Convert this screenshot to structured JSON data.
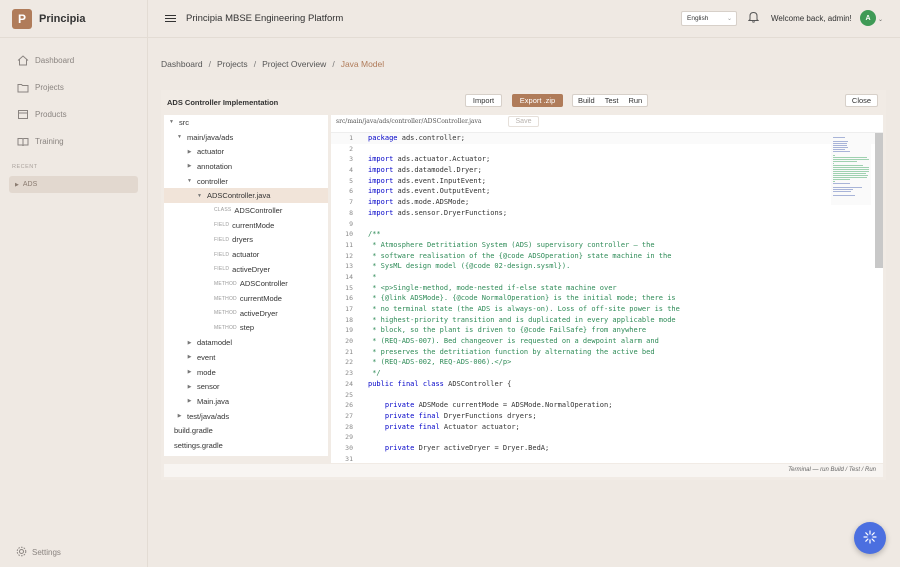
{
  "brand": {
    "logo": "P",
    "name": "Principia"
  },
  "nav": [
    {
      "label": "Dashboard",
      "icon": "home-icon"
    },
    {
      "label": "Projects",
      "icon": "folder-icon"
    },
    {
      "label": "Products",
      "icon": "box-icon"
    },
    {
      "label": "Training",
      "icon": "book-icon"
    }
  ],
  "recent": {
    "label": "RECENT",
    "items": [
      "ADS"
    ]
  },
  "settings": {
    "label": "Settings",
    "icon": "gear-icon"
  },
  "header": {
    "title": "Principia MBSE Engineering Platform",
    "language": "English",
    "welcome": "Welcome back, admin!",
    "avatar": "A"
  },
  "breadcrumb": [
    "Dashboard",
    "Projects",
    "Project Overview",
    "Java Model"
  ],
  "panel": {
    "title": "ADS Controller Implementation",
    "import": "Import",
    "export": "Export .zip",
    "build": "Build",
    "test": "Test",
    "run": "Run",
    "close": "Close"
  },
  "tree": [
    {
      "label": "src",
      "indent": 0,
      "arrow": "open"
    },
    {
      "label": "main/java/ads",
      "indent": 1,
      "arrow": "open"
    },
    {
      "label": "actuator",
      "indent": 2,
      "arrow": "closed"
    },
    {
      "label": "annotation",
      "indent": 2,
      "arrow": "closed"
    },
    {
      "label": "controller",
      "indent": 2,
      "arrow": "open"
    },
    {
      "label": "ADSController.java",
      "indent": 3,
      "arrow": "open",
      "selected": true
    },
    {
      "label": "ADSController",
      "indent": 4,
      "kind": "CLASS"
    },
    {
      "label": "currentMode",
      "indent": 4,
      "kind": "FIELD"
    },
    {
      "label": "dryers",
      "indent": 4,
      "kind": "FIELD"
    },
    {
      "label": "actuator",
      "indent": 4,
      "kind": "FIELD"
    },
    {
      "label": "activeDryer",
      "indent": 4,
      "kind": "FIELD"
    },
    {
      "label": "ADSController",
      "indent": 4,
      "kind": "METHOD"
    },
    {
      "label": "currentMode",
      "indent": 4,
      "kind": "METHOD"
    },
    {
      "label": "activeDryer",
      "indent": 4,
      "kind": "METHOD"
    },
    {
      "label": "step",
      "indent": 4,
      "kind": "METHOD"
    },
    {
      "label": "datamodel",
      "indent": 2,
      "arrow": "closed"
    },
    {
      "label": "event",
      "indent": 2,
      "arrow": "closed"
    },
    {
      "label": "mode",
      "indent": 2,
      "arrow": "closed"
    },
    {
      "label": "sensor",
      "indent": 2,
      "arrow": "closed"
    },
    {
      "label": "Main.java",
      "indent": 2,
      "arrow": "closed"
    },
    {
      "label": "test/java/ads",
      "indent": 1,
      "arrow": "closed"
    },
    {
      "label": "build.gradle",
      "indent": 0
    },
    {
      "label": "settings.gradle",
      "indent": 0
    }
  ],
  "editor": {
    "path": "src/main/java/ads/controller/ADSController.java",
    "save": "Save",
    "lines": [
      {
        "n": "1",
        "t": "package ads.controller;"
      },
      {
        "n": "2",
        "t": ""
      },
      {
        "n": "3",
        "t": "import ads.actuator.Actuator;"
      },
      {
        "n": "4",
        "t": "import ads.datamodel.Dryer;"
      },
      {
        "n": "5",
        "t": "import ads.event.InputEvent;"
      },
      {
        "n": "6",
        "t": "import ads.event.OutputEvent;"
      },
      {
        "n": "7",
        "t": "import ads.mode.ADSMode;"
      },
      {
        "n": "8",
        "t": "import ads.sensor.DryerFunctions;"
      },
      {
        "n": "9",
        "t": ""
      },
      {
        "n": "10",
        "t": "/**",
        "c": true
      },
      {
        "n": "11",
        "t": " * Atmosphere Detritiation System (ADS) supervisory controller — the",
        "c": true
      },
      {
        "n": "12",
        "t": " * software realisation of the {@code ADSOperation} state machine in the",
        "c": true
      },
      {
        "n": "13",
        "t": " * SysML design model ({@code 02-design.sysml}).",
        "c": true
      },
      {
        "n": "14",
        "t": " *",
        "c": true
      },
      {
        "n": "15",
        "t": " * <p>Single-method, mode-nested if-else state machine over",
        "c": true
      },
      {
        "n": "16",
        "t": " * {@link ADSMode}. {@code NormalOperation} is the initial mode; there is",
        "c": true
      },
      {
        "n": "17",
        "t": " * no terminal state (the ADS is always-on). Loss of off-site power is the",
        "c": true
      },
      {
        "n": "18",
        "t": " * highest-priority transition and is duplicated in every applicable mode",
        "c": true
      },
      {
        "n": "19",
        "t": " * block, so the plant is driven to {@code FailSafe} from anywhere",
        "c": true
      },
      {
        "n": "20",
        "t": " * (REQ-ADS-007). Bed changeover is requested on a dewpoint alarm and",
        "c": true
      },
      {
        "n": "21",
        "t": " * preserves the detritiation function by alternating the active bed",
        "c": true
      },
      {
        "n": "22",
        "t": " * (REQ-ADS-002, REQ-ADS-006).</p>",
        "c": true
      },
      {
        "n": "23",
        "t": " */",
        "c": true
      },
      {
        "n": "24",
        "t": "public final class ADSController {"
      },
      {
        "n": "25",
        "t": ""
      },
      {
        "n": "26",
        "t": "    private ADSMode currentMode = ADSMode.NormalOperation;"
      },
      {
        "n": "27",
        "t": "    private final DryerFunctions dryers;"
      },
      {
        "n": "28",
        "t": "    private final Actuator actuator;"
      },
      {
        "n": "29",
        "t": ""
      },
      {
        "n": "30",
        "t": "    private Dryer activeDryer = Dryer.BedA;"
      },
      {
        "n": "31",
        "t": ""
      }
    ]
  },
  "terminal_note": "Terminal — run Build / Test / Run",
  "colors": {
    "accent": "#b07c5a",
    "fab": "#4b6fe0",
    "comment": "#2e8b57",
    "keyword": "#0000c8"
  }
}
